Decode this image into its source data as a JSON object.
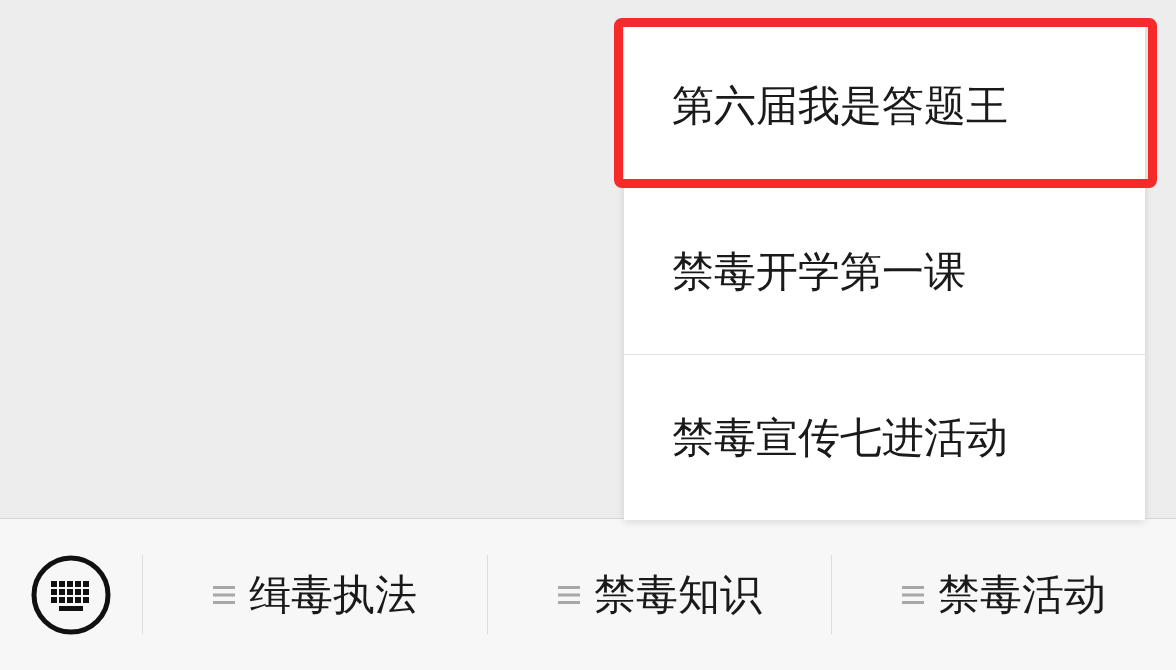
{
  "popup_menu": {
    "items": [
      {
        "label": "第六届我是答题王",
        "selected": true
      },
      {
        "label": "禁毒开学第一课",
        "selected": false
      },
      {
        "label": "禁毒宣传七进活动",
        "selected": false
      }
    ]
  },
  "bottom_bar": {
    "menus": [
      {
        "label": "缉毒执法"
      },
      {
        "label": "禁毒知识"
      },
      {
        "label": "禁毒活动"
      }
    ]
  }
}
